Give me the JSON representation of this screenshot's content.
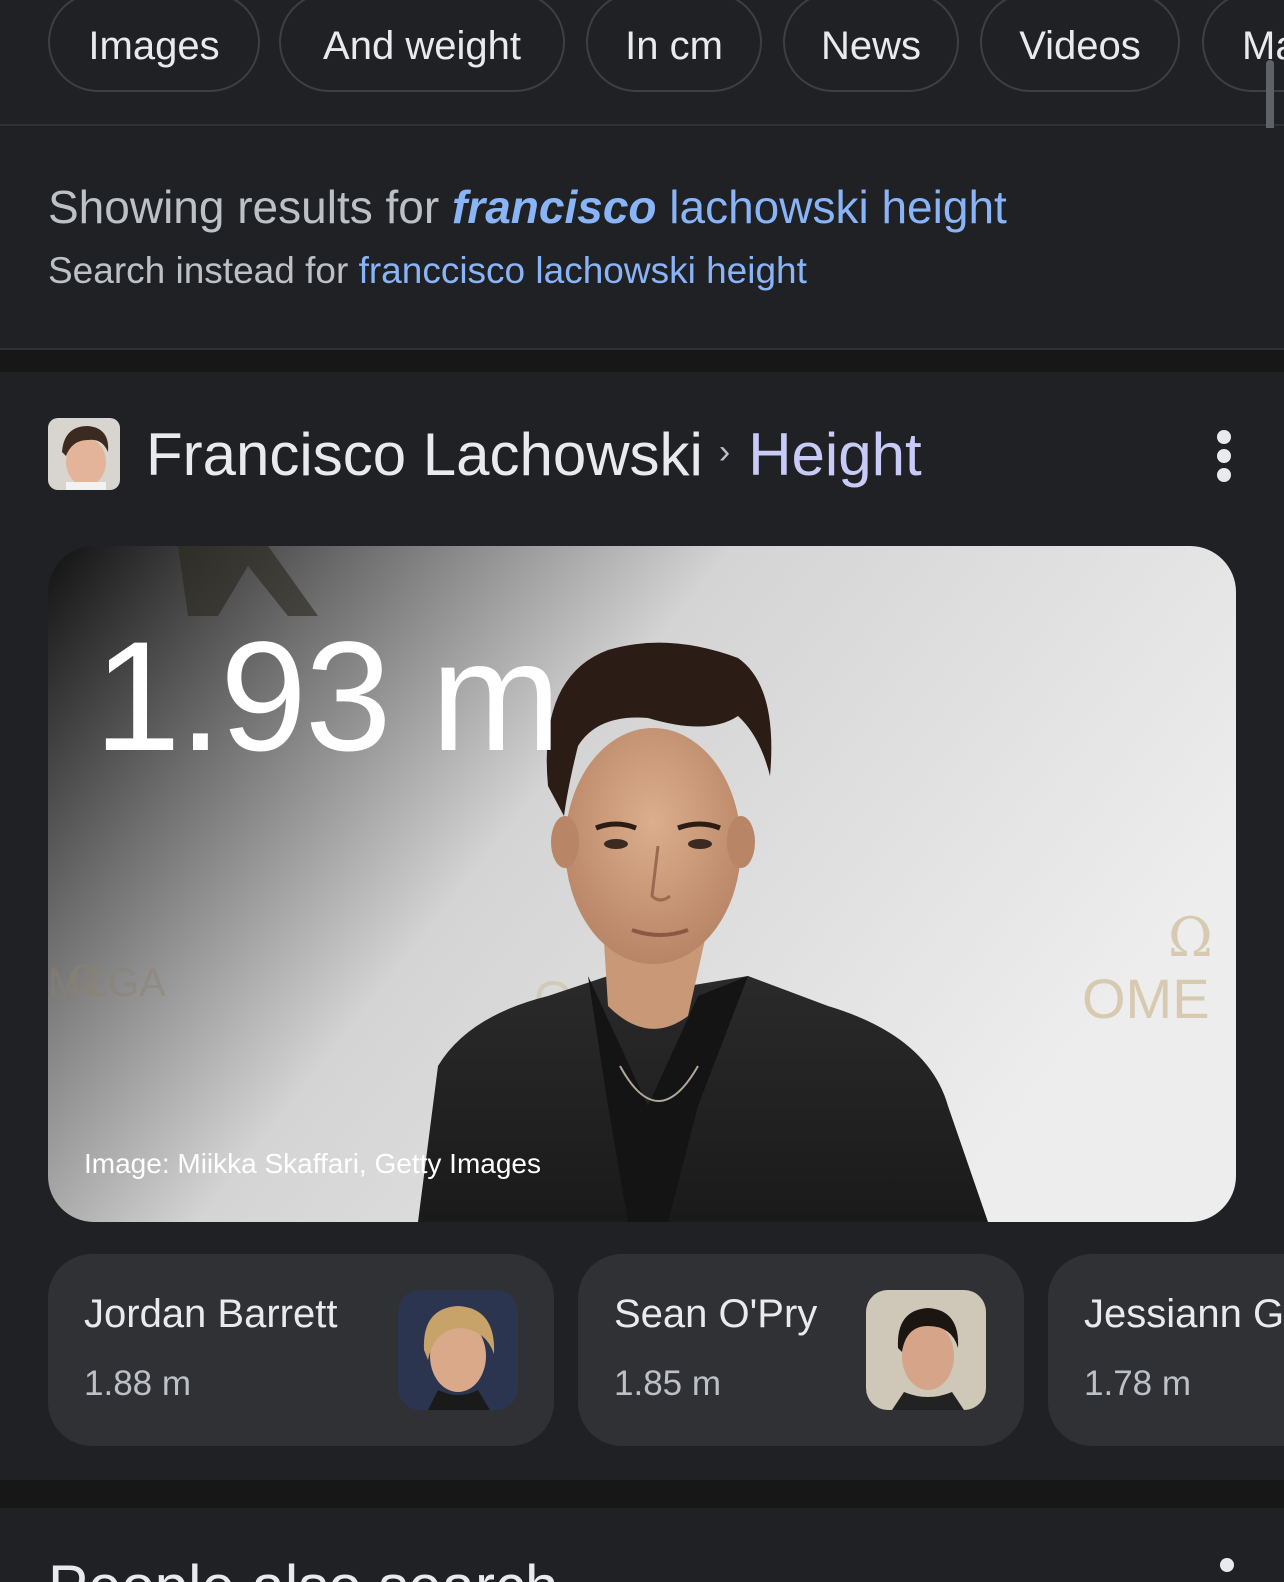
{
  "chips": [
    "Images",
    "And weight",
    "In cm",
    "News",
    "Videos",
    "Ma"
  ],
  "spelling": {
    "showing_prefix": "Showing results for",
    "corrected_bold": "francisco",
    "corrected_rest": "lachowski height",
    "instead_prefix": "Search instead for",
    "instead_query": "franccisco lachowski height"
  },
  "knowledge": {
    "entity": "Francisco Lachowski",
    "chevron": "›",
    "attribute": "Height",
    "value": "1.93 m",
    "image_credit": "Image: Miikka Skaffari, Getty Images"
  },
  "related": [
    {
      "name": "Jordan Barrett",
      "value": "1.88 m"
    },
    {
      "name": "Sean O'Pry",
      "value": "1.85 m"
    },
    {
      "name": "Jessiann G",
      "value": "1.78 m"
    }
  ],
  "next_section_title": "People also search",
  "colors": {
    "background": "#202124",
    "link": "#8ab4f8",
    "chip_border": "#3c4043",
    "card_bg": "#303134"
  }
}
